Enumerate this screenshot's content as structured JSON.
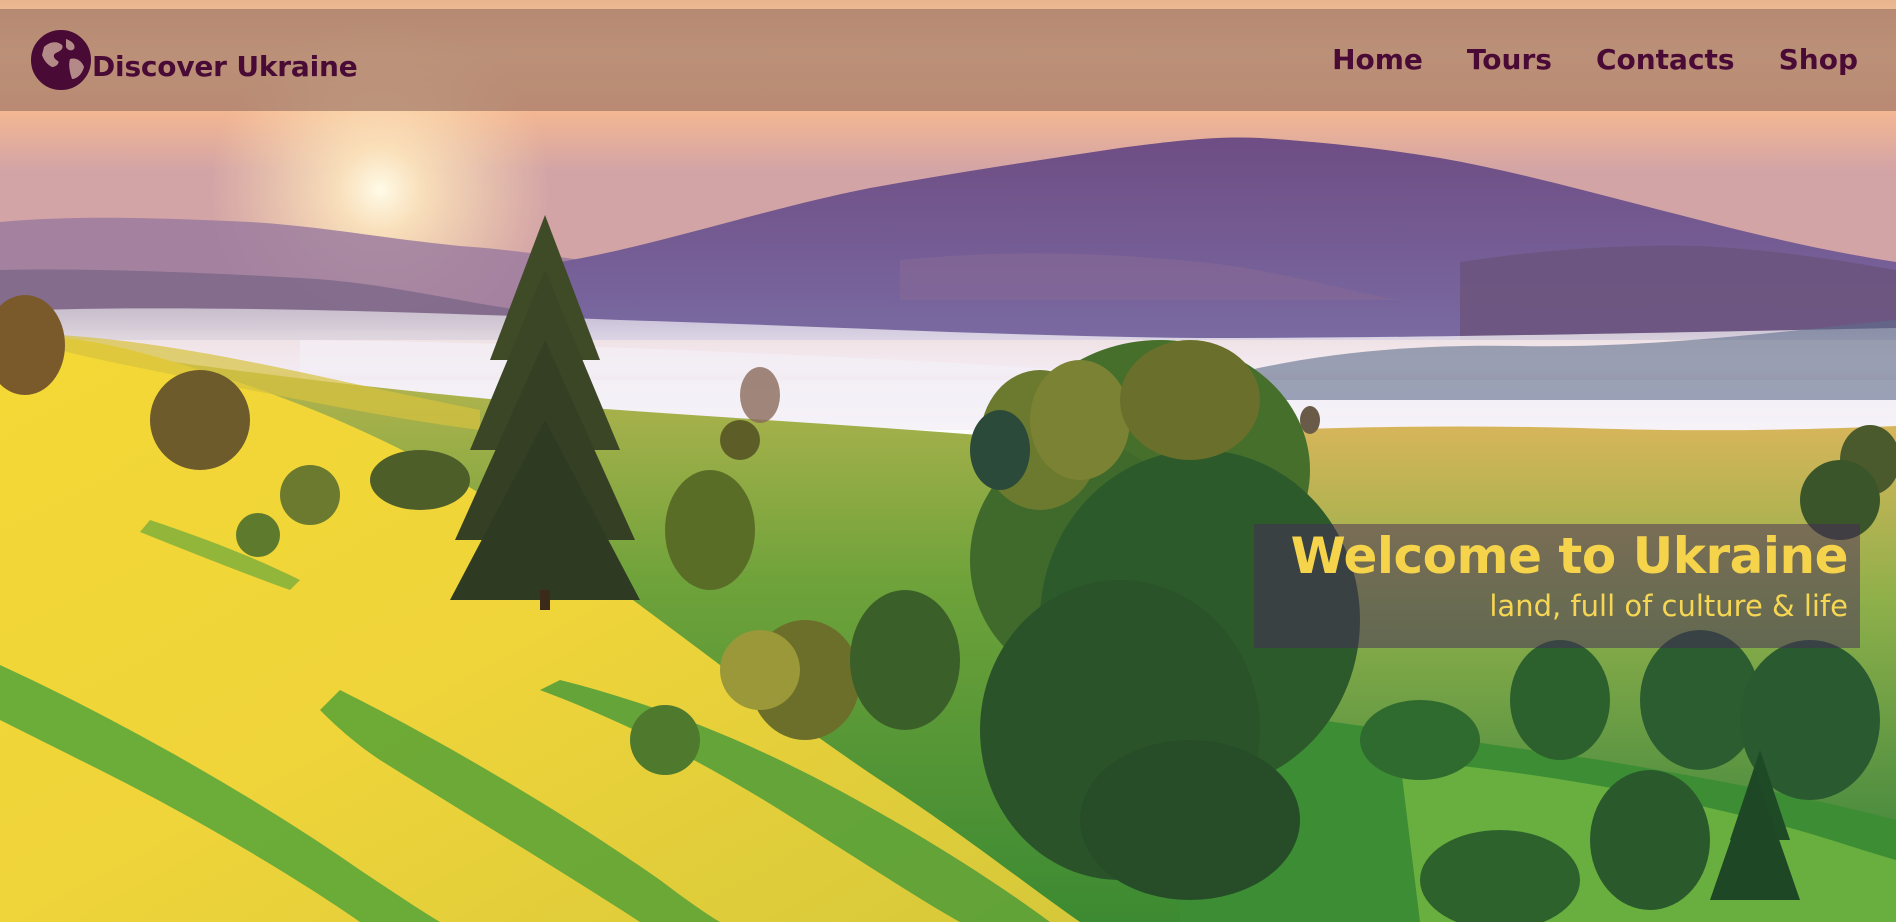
{
  "header": {
    "brand_name": "Discover Ukraine",
    "logo_icon": "globe-icon",
    "nav": [
      {
        "label": "Home"
      },
      {
        "label": "Tours"
      },
      {
        "label": "Contacts"
      },
      {
        "label": "Shop"
      }
    ]
  },
  "hero": {
    "title": "Welcome to Ukraine",
    "subtitle": "land, full of culture & life"
  },
  "colors": {
    "brand": "#4a0a36",
    "accent": "#f5d44c",
    "header_bg": "#966e5f"
  }
}
